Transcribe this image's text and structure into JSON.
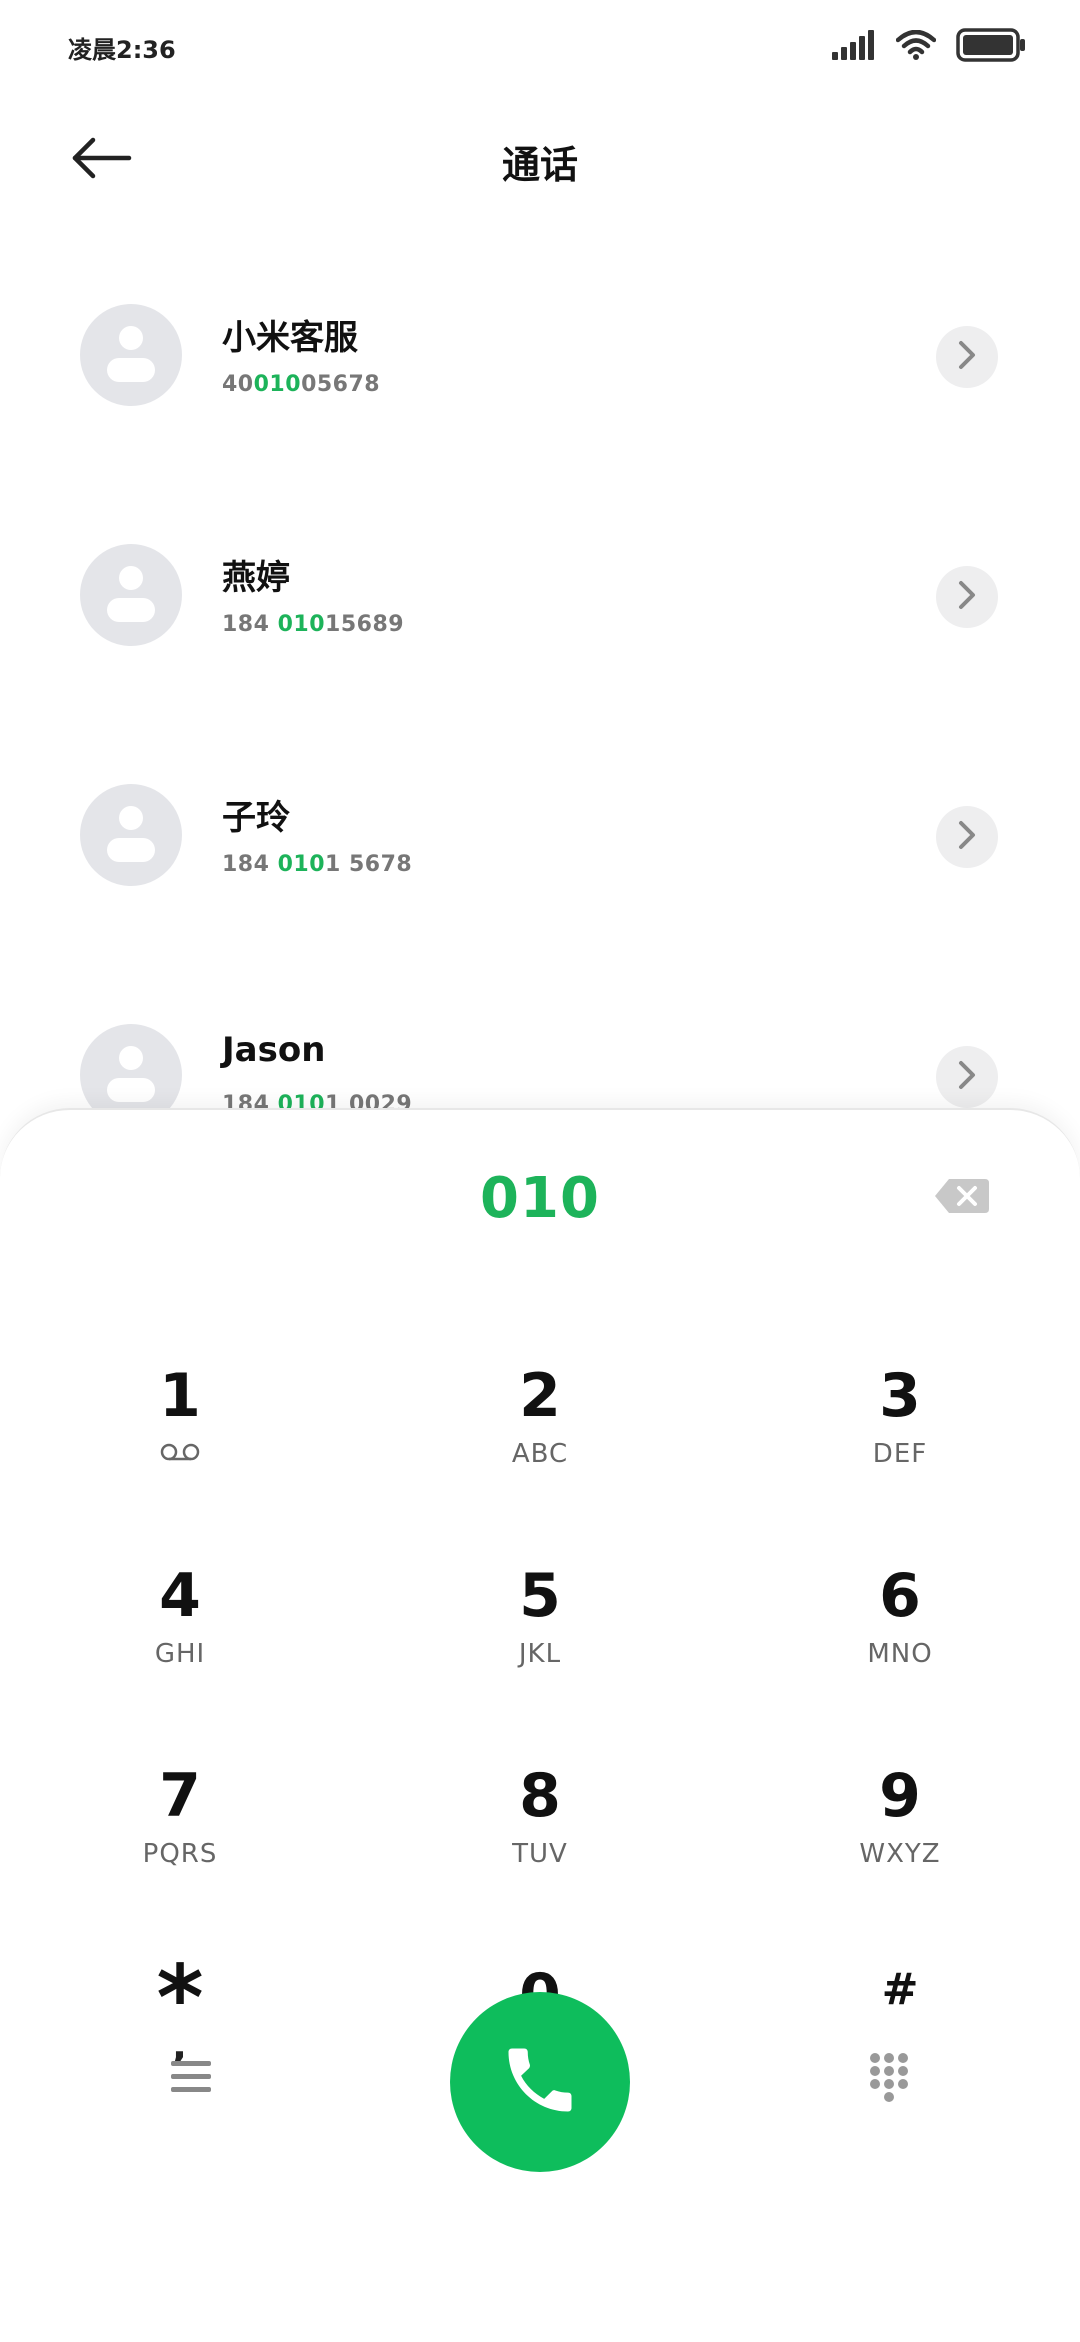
{
  "status_bar": {
    "time": "凌晨2:36",
    "icons": [
      "signal-icon",
      "wifi-icon",
      "battery-icon"
    ]
  },
  "header": {
    "title": "通话",
    "back_icon": "arrow-left-icon"
  },
  "contacts": [
    {
      "name": "小米客服",
      "number_prefix": "40",
      "number_match": "010",
      "number_suffix": "05678"
    },
    {
      "name": "燕婷",
      "number_prefix": "184 ",
      "number_match": "010",
      "number_suffix": "15689"
    },
    {
      "name": "子玲",
      "number_prefix": "184 ",
      "number_match": "010",
      "number_suffix": "1 5678"
    },
    {
      "name": "Jason",
      "number_prefix": "184 ",
      "number_match": "010",
      "number_suffix": "1 0029"
    }
  ],
  "dialer": {
    "input_value": "010",
    "keys": [
      {
        "digit": "1",
        "letters": "",
        "icon": "voicemail-icon"
      },
      {
        "digit": "2",
        "letters": "ABC"
      },
      {
        "digit": "3",
        "letters": "DEF"
      },
      {
        "digit": "4",
        "letters": "GHI"
      },
      {
        "digit": "5",
        "letters": "JKL"
      },
      {
        "digit": "6",
        "letters": "MNO"
      },
      {
        "digit": "7",
        "letters": "PQRS"
      },
      {
        "digit": "8",
        "letters": "TUV"
      },
      {
        "digit": "9",
        "letters": "WXYZ"
      },
      {
        "digit": "*",
        "letters": ","
      },
      {
        "digit": "0",
        "letters": "+"
      },
      {
        "digit": "#",
        "letters": ""
      }
    ]
  },
  "bottom_actions": {
    "menu_icon": "menu-icon",
    "call_icon": "phone-icon",
    "dialpad_icon": "dialpad-icon"
  },
  "colors": {
    "accent": "#1db35a",
    "call_button": "#0ebd5c",
    "avatar_bg": "#e4e5e9"
  }
}
